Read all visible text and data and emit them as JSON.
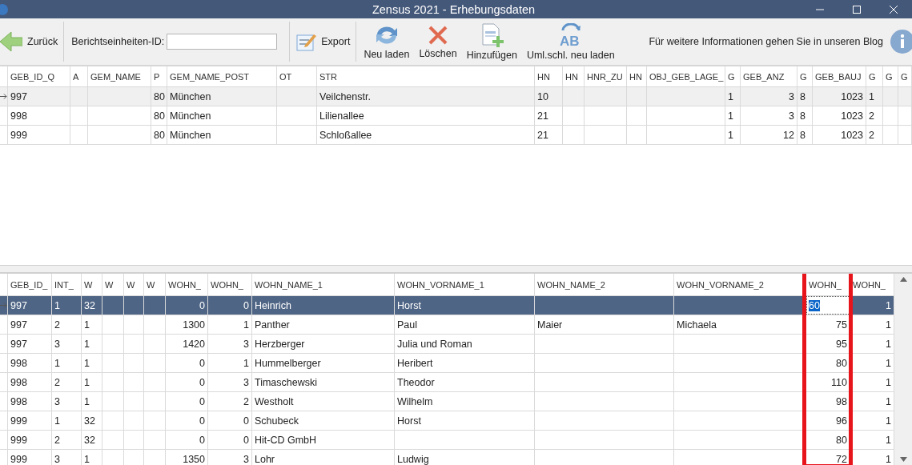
{
  "window": {
    "title": "Zensus 2021 - Erhebungsdaten"
  },
  "toolbar": {
    "back": "Zurück",
    "id_label": "Berichtseinheiten-ID:",
    "export": "Export",
    "buttons": [
      {
        "kind": "reload",
        "label": "Neu laden"
      },
      {
        "kind": "delete",
        "label": "Löschen"
      },
      {
        "kind": "add",
        "label": "Hinzufügen"
      },
      {
        "kind": "keys",
        "label": "Uml.schl. neu laden",
        "icon_text": "AB"
      }
    ],
    "info": "Für weitere Informationen gehen Sie in unseren Blog"
  },
  "top_table": {
    "columns": [
      "GEB_ID_Q",
      "A",
      "GEM_NAME",
      "P",
      "GEM_NAME_POST",
      "OT",
      "STR",
      "HN",
      "HN",
      "HNR_ZU",
      "HN",
      "OBJ_GEB_LAGE_",
      "G",
      "GEB_ANZ",
      "G",
      "GEB_BAUJ",
      "G",
      "G",
      "G"
    ],
    "rows": [
      {
        "selected": true,
        "cells": [
          "997",
          "",
          "",
          "80",
          "München",
          "",
          "Veilchenstr.",
          "10",
          "",
          "",
          "",
          "",
          "1",
          "3",
          "8",
          "1023",
          "1",
          "",
          ""
        ]
      },
      {
        "selected": false,
        "cells": [
          "998",
          "",
          "",
          "80",
          "München",
          "",
          "Lilienallee",
          "21",
          "",
          "",
          "",
          "",
          "1",
          "3",
          "8",
          "1023",
          "2",
          "",
          ""
        ]
      },
      {
        "selected": false,
        "cells": [
          "999",
          "",
          "",
          "80",
          "München",
          "",
          "Schloßallee",
          "21",
          "",
          "",
          "",
          "",
          "1",
          "12",
          "8",
          "1023",
          "2",
          "",
          ""
        ]
      }
    ]
  },
  "bottom_table": {
    "columns": [
      {
        "label": "GEB_ID_",
        "highlighted": false
      },
      {
        "label": "INT_",
        "highlighted": false
      },
      {
        "label": "W",
        "highlighted": false
      },
      {
        "label": "W",
        "highlighted": false
      },
      {
        "label": "W",
        "highlighted": false
      },
      {
        "label": "W",
        "highlighted": false
      },
      {
        "label": "WOHN_",
        "highlighted": false
      },
      {
        "label": "WOHN_",
        "highlighted": false
      },
      {
        "label": "WOHN_NAME_1",
        "highlighted": false
      },
      {
        "label": "WOHN_VORNAME_1",
        "highlighted": false
      },
      {
        "label": "WOHN_NAME_2",
        "highlighted": false
      },
      {
        "label": "WOHN_VORNAME_2",
        "highlighted": false
      },
      {
        "label": "WOHN_",
        "highlighted": true
      },
      {
        "label": "WOHN_",
        "highlighted": false
      }
    ],
    "rows": [
      {
        "selected": true,
        "editing": true,
        "cells": [
          "997",
          "1",
          "32",
          "",
          "",
          "",
          "0",
          "0",
          "Heinrich",
          "Horst",
          "",
          "",
          "60",
          "1"
        ]
      },
      {
        "selected": false,
        "cells": [
          "997",
          "2",
          "1",
          "",
          "",
          "",
          "1300",
          "1",
          "Panther",
          "Paul",
          "Maier",
          "Michaela",
          "75",
          "1"
        ]
      },
      {
        "selected": false,
        "cells": [
          "997",
          "3",
          "1",
          "",
          "",
          "",
          "1420",
          "3",
          "Herzberger",
          "Julia und  Roman",
          "",
          "",
          "95",
          "1"
        ]
      },
      {
        "selected": false,
        "cells": [
          "998",
          "1",
          "1",
          "",
          "",
          "",
          "0",
          "1",
          "Hummelberger",
          "Heribert",
          "",
          "",
          "80",
          "1"
        ]
      },
      {
        "selected": false,
        "cells": [
          "998",
          "2",
          "1",
          "",
          "",
          "",
          "0",
          "3",
          "Timaschewski",
          "Theodor",
          "",
          "",
          "110",
          "1"
        ]
      },
      {
        "selected": false,
        "cells": [
          "998",
          "3",
          "1",
          "",
          "",
          "",
          "0",
          "2",
          "Westholt",
          "Wilhelm",
          "",
          "",
          "98",
          "1"
        ]
      },
      {
        "selected": false,
        "cells": [
          "999",
          "1",
          "32",
          "",
          "",
          "",
          "0",
          "0",
          "Schubeck",
          "Horst",
          "",
          "",
          "96",
          "1"
        ]
      },
      {
        "selected": false,
        "cells": [
          "999",
          "2",
          "32",
          "",
          "",
          "",
          "0",
          "0",
          "Hit-CD GmbH",
          "",
          "",
          "",
          "80",
          "1"
        ]
      },
      {
        "selected": false,
        "cells": [
          "999",
          "3",
          "1",
          "",
          "",
          "",
          "1350",
          "3",
          "Lohr",
          "Ludwig",
          "",
          "",
          "72",
          "1"
        ]
      }
    ]
  }
}
